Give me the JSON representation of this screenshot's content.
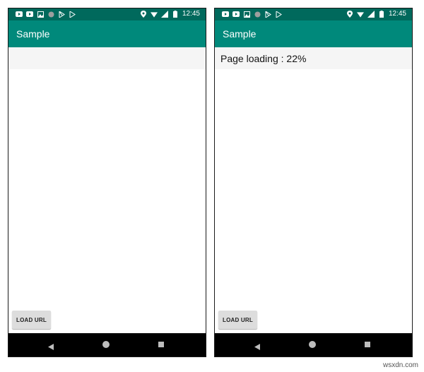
{
  "status_bar": {
    "time": "12:45"
  },
  "app_bar": {
    "title": "Sample"
  },
  "screens": [
    {
      "id": "initial",
      "loading_text": "",
      "button_label": "LOAD URL"
    },
    {
      "id": "loading",
      "loading_text": "Page loading : 22%",
      "progress_percent": 22,
      "button_label": "LOAD URL"
    }
  ],
  "colors": {
    "status_bar": "#00695c",
    "app_bar": "#00897b",
    "nav_bar": "#000000",
    "button": "#dddddd"
  },
  "icons": {
    "status_left": [
      "youtube-icon",
      "youtube-icon",
      "image-icon",
      "circle-icon",
      "play-store-icon",
      "play-icon"
    ],
    "status_right": [
      "location-icon",
      "wifi-icon",
      "signal-icon",
      "battery-icon"
    ],
    "nav": [
      "back-icon",
      "home-icon",
      "recents-icon"
    ]
  },
  "watermark": "wsxdn.com"
}
